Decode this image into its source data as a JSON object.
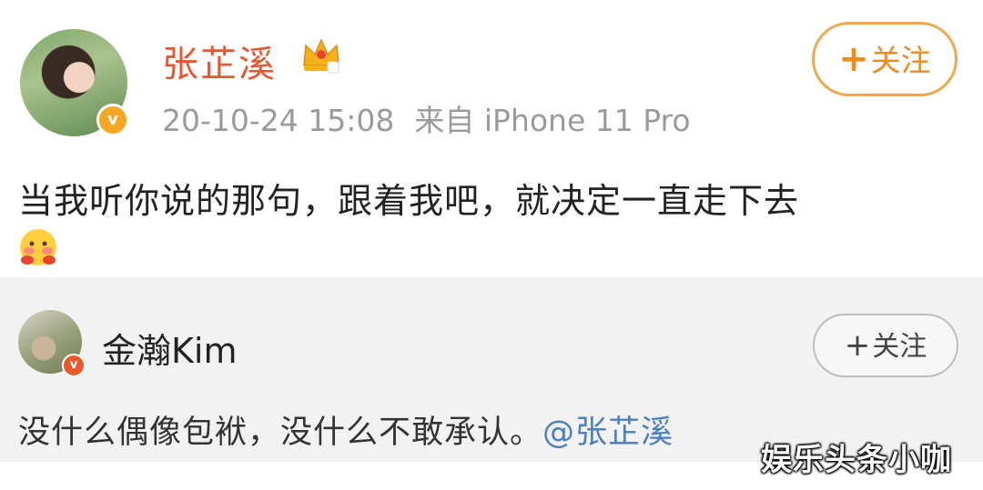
{
  "post": {
    "author": "张芷溪",
    "timestamp": "20-10-24 15:08",
    "source": "来自 iPhone 11 Pro",
    "follow_label": "关注",
    "follow_plus": "+",
    "content": "当我听你说的那句，跟着我吧，就决定一直走下去",
    "verified_badge": "v",
    "icons": [
      "avatar",
      "verified-badge-icon",
      "crown-vip-icon",
      "shy-face-emoji-icon"
    ]
  },
  "repost": {
    "author": "金瀚Kim",
    "follow_label": "关注",
    "follow_plus": "+",
    "content": "没什么偶像包袱，没什么不敢承认。",
    "mention": "@张芷溪",
    "verified_badge": "v"
  },
  "watermark": "娱乐头条小咖",
  "colors": {
    "author_name": "#e8562f",
    "follow_accent": "#f08a1c",
    "mention": "#4a7fc1",
    "repost_bg": "#f2f2f2",
    "meta_gray": "#9a9a9a"
  }
}
